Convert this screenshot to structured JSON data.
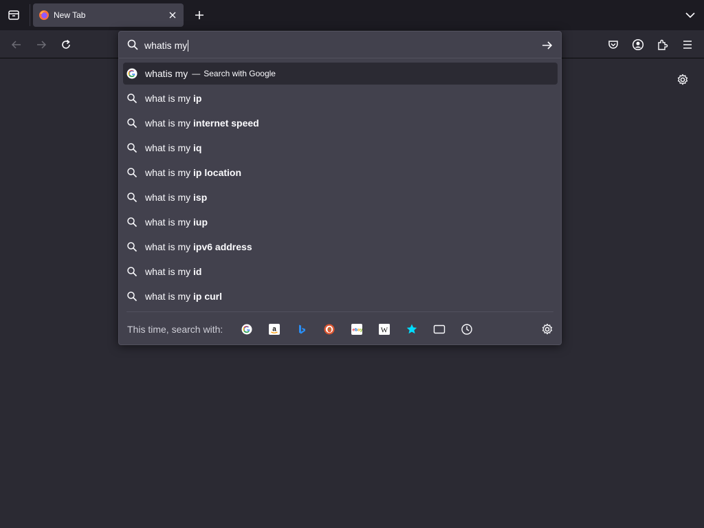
{
  "tabs": [
    {
      "title": "New Tab",
      "active": true
    }
  ],
  "urlbar": {
    "value": "whatis my",
    "results": [
      {
        "type": "search-engine",
        "icon": "google-icon",
        "query": "whatis my",
        "separator": "—",
        "action": "Search with Google",
        "selected": true
      },
      {
        "type": "suggestion",
        "prefix": "what is my ",
        "bold": "ip"
      },
      {
        "type": "suggestion",
        "prefix": "what is my ",
        "bold": "internet speed"
      },
      {
        "type": "suggestion",
        "prefix": "what is my ",
        "bold": "iq"
      },
      {
        "type": "suggestion",
        "prefix": "what is my ",
        "bold": "ip location"
      },
      {
        "type": "suggestion",
        "prefix": "what is my ",
        "bold": "isp"
      },
      {
        "type": "suggestion",
        "prefix": "what is my ",
        "bold": "iup"
      },
      {
        "type": "suggestion",
        "prefix": "what is my ",
        "bold": "ipv6 address"
      },
      {
        "type": "suggestion",
        "prefix": "what is my ",
        "bold": "id"
      },
      {
        "type": "suggestion",
        "prefix": "what is my ",
        "bold": "ip curl"
      }
    ],
    "oneoff": {
      "label": "This time, search with:",
      "engines": [
        "google-icon",
        "amazon-icon",
        "bing-icon",
        "duckduckgo-icon",
        "ebay-icon",
        "wikipedia-icon",
        "bookmarks-icon",
        "tabs-icon",
        "history-icon"
      ]
    }
  },
  "colors": {
    "background": "#2b2a33",
    "tabstrip": "#1c1b22",
    "popup": "#42414d",
    "selected_row": "#2b2a33",
    "text": "#fbfbfe",
    "bookmark_star": "#00ddff"
  }
}
